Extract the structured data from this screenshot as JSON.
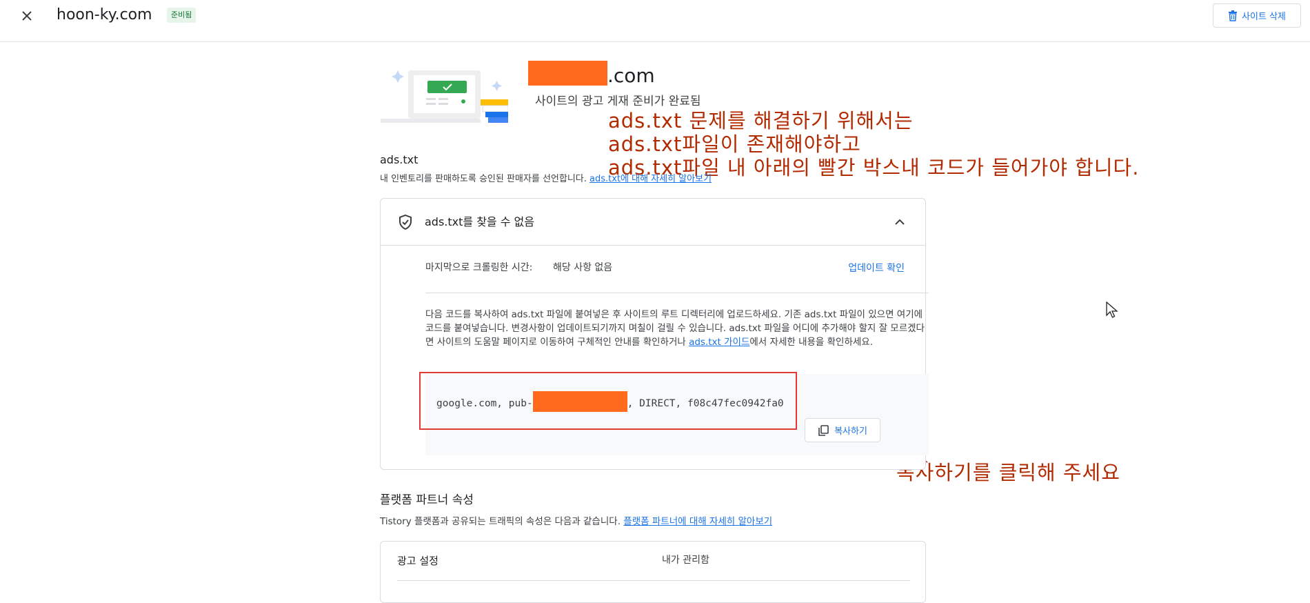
{
  "header": {
    "close_icon": "close-icon",
    "site_name": "hoon-ky.com",
    "status_chip": "준비됨",
    "delete_button_label": "사이트 삭제",
    "delete_icon": "trash-icon"
  },
  "hero": {
    "domain_suffix": ".com",
    "subtitle": "사이트의 광고 게재 준비가 완료됨",
    "illustration": "laptop-check-illustration",
    "redaction_color": "#ff6a1f"
  },
  "annotations": {
    "top_lines": [
      "ads.txt 문제를 해결하기 위해서는",
      "ads.txt파일이 존재해야하고",
      "ads.txt파일 내 아래의 빨간 박스내 코드가 들어가야 합니다."
    ],
    "bottom": "복사하기를 클릭해 주세요",
    "color": "#b22a00"
  },
  "ads_txt": {
    "title": "ads.txt",
    "description": "내 인벤토리를 판매하도록 승인된 판매자를 선언합니다.",
    "learn_more_link": "ads.txt에 대해 자세히 알아보기",
    "card": {
      "status_icon": "shield-check-icon",
      "status_text": "ads.txt를 찾을 수 없음",
      "collapse_icon": "chevron-up-icon",
      "last_crawled_label": "마지막으로 크롤링한 시간:",
      "last_crawled_value": "해당 사항 없음",
      "check_update_link": "업데이트 확인",
      "instructions_text": "다음 코드를 복사하여 ads.txt 파일에 붙여넣은 후 사이트의 루트 디렉터리에 업로드하세요. 기존 ads.txt 파일이 있으면 여기에 코드를 붙여넣습니다. 변경사항이 업데이트되기까지 며칠이 걸릴 수 있습니다. ads.txt 파일을 어디에 추가해야 할지 잘 모르겠다면 사이트의 도움말 페이지로 이동하여 구체적인 안내를 확인하거나 ",
      "guide_link": "ads.txt 가이드",
      "instructions_suffix": "에서 자세한 내용을 확인하세요.",
      "code_prefix": "google.com, pub-",
      "code_suffix": ", DIRECT, f08c47fec0942fa0",
      "copy_button_label": "복사하기",
      "copy_icon": "copy-icon"
    }
  },
  "platform_partner": {
    "title": "플랫폼 파트너 속성",
    "description": "Tistory 플랫폼과 공유되는 트래픽의 속성은 다음과 같습니다.",
    "learn_more_link": "플랫폼 파트너에 대해 자세히 알아보기",
    "rows": [
      {
        "label": "광고 설정",
        "value": "내가 관리함"
      }
    ]
  },
  "colors": {
    "accent": "#1a73e8",
    "chip_bg": "#e6f4ea",
    "chip_text": "#137333",
    "highlight_box": "#e53935"
  }
}
